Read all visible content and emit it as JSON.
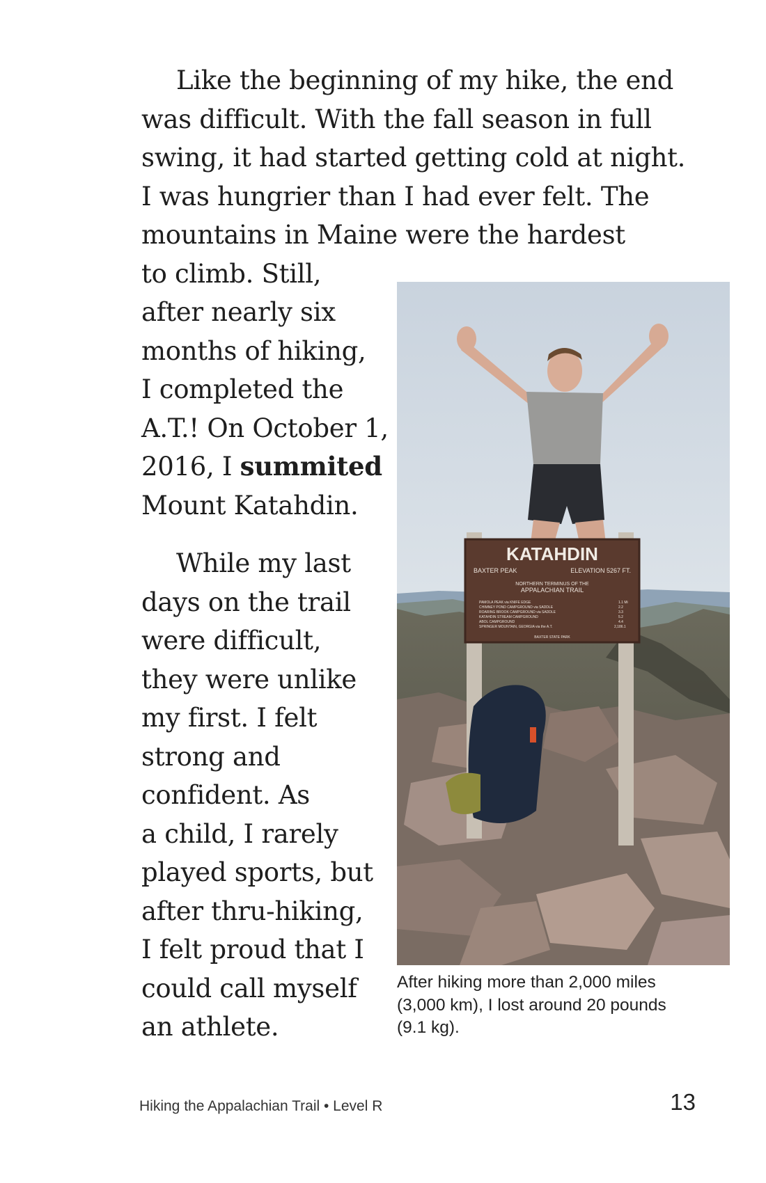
{
  "paragraph1": {
    "lines": [
      "Like the beginning of my hike, the end",
      "was difficult. With the fall season in full",
      "swing, it had started getting cold at night.",
      "I was hungrier than I had ever felt. The",
      "mountains in Maine were the hardest",
      "to climb. Still,",
      "after nearly six",
      "months of hiking,",
      "I completed the",
      "A.T.! On October 1,"
    ],
    "line11_before": "2016, I ",
    "line11_bold": "summited",
    "line12": "Mount Katahdin."
  },
  "paragraph2": {
    "lines": [
      "While my last",
      "days on the trail",
      "were difficult,",
      "they were unlike",
      "my first. I felt",
      "strong and",
      "confident. As",
      "a child, I rarely",
      "played sports, but",
      "after thru-hiking,",
      "I felt proud that I",
      "could call myself",
      "an athlete."
    ]
  },
  "photo": {
    "sign": {
      "title": "KATAHDIN",
      "left_sub": "BAXTER PEAK",
      "right_sub": "ELEVATION 5267 FT.",
      "terminus_1": "NORTHERN TERMINUS OF THE",
      "terminus_2": "APPALACHIAN TRAIL",
      "trails": [
        "PAMOLA PEAK via KNIFE EDGE",
        "CHIMNEY POND CAMPGROUND via SADDLE",
        "ROARING BROOK CAMPGROUND via SADDLE",
        "KATAHDIN STREAM CAMPGROUND",
        "ABOL CAMPGROUND",
        "SPRINGER MOUNTAIN, GEORGIA via the A.T."
      ],
      "distances": [
        "1.1 Mi",
        "2.2",
        "3.3",
        "5.2",
        "4.4",
        "2,186.1"
      ],
      "park": "BAXTER STATE PARK"
    }
  },
  "caption": {
    "lines": [
      "After hiking more than 2,000 miles",
      "(3,000 km), I lost around 20 pounds",
      "(9.1 kg)."
    ]
  },
  "footer": {
    "title": "Hiking the Appalachian Trail • Level R",
    "page": "13"
  }
}
